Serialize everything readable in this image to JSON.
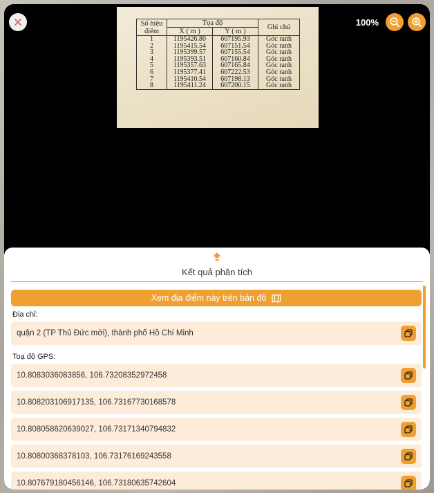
{
  "viewer": {
    "zoom_level": "100%"
  },
  "document_table": {
    "headers": {
      "point_line1": "Số hiệu",
      "point_line2": "điểm",
      "coords": "Tọa độ",
      "x": "X ( m )",
      "y": "Y ( m )",
      "note": "Ghi chú"
    },
    "rows": [
      {
        "num": "1",
        "x": "1195426.80",
        "y": "607195.93",
        "note": "Góc ranh"
      },
      {
        "num": "2",
        "x": "1195415.54",
        "y": "607151.54",
        "note": "Góc ranh"
      },
      {
        "num": "3",
        "x": "1195399.57",
        "y": "607155.54",
        "note": "Góc ranh"
      },
      {
        "num": "4",
        "x": "1195393.51",
        "y": "607160.84",
        "note": "Góc ranh"
      },
      {
        "num": "5",
        "x": "1195357.63",
        "y": "607165.84",
        "note": "Góc ranh"
      },
      {
        "num": "6",
        "x": "1195377.41",
        "y": "607222.53",
        "note": "Góc ranh"
      },
      {
        "num": "7",
        "x": "1195410.54",
        "y": "607198.13",
        "note": "Góc ranh"
      },
      {
        "num": "8",
        "x": "1195411.24",
        "y": "607200.15",
        "note": "Góc ranh"
      }
    ]
  },
  "results": {
    "title": "Kết quả phân tích",
    "map_button_label": "Xem địa điểm này trên bản đồ",
    "address_label": "Địa chỉ:",
    "address_value": "quận 2 (TP Thủ Đức mới), thành phố Hồ Chí Minh",
    "gps_label": "Toạ độ GPS:",
    "gps_values": [
      "10.8083036083856, 106.73208352972458",
      "10.808203106917135, 106.73167730168578",
      "10.808058620639027, 106.73171340794832",
      "10.80800368378103, 106.73176169243558",
      "10.807679180456146, 106.73180635742604"
    ]
  },
  "colors": {
    "accent": "#f0a030",
    "row_bg": "#fdecd9",
    "close_x": "#e05a5a"
  }
}
